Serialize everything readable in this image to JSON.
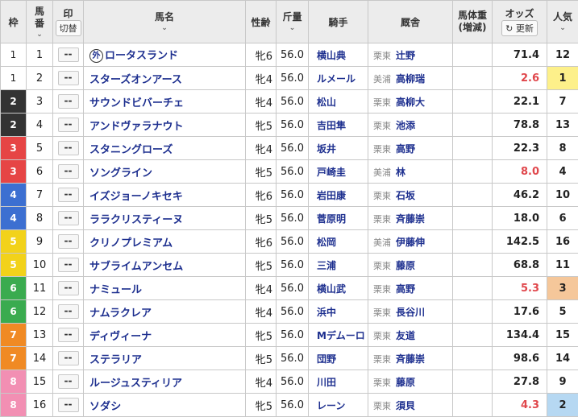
{
  "header": {
    "waku": "枠",
    "umaban_1": "馬",
    "umaban_2": "番",
    "mark": "印",
    "mark_toggle": "切替",
    "horse": "馬名",
    "sex_age": "性齢",
    "weight": "斤量",
    "jockey": "騎手",
    "trainer": "厩舎",
    "body_1": "馬体重",
    "body_2": "(増減)",
    "odds": "オッズ",
    "refresh": "更新",
    "pop_1": "人",
    "pop_2": "気"
  },
  "colors": {
    "waku": {
      "1": "#ffffff",
      "2": "#333333",
      "3": "#e64545",
      "4": "#3c6fd1",
      "5": "#f2d21a",
      "6": "#3aab4f",
      "7": "#f08a24",
      "8": "#f28fb3"
    },
    "waku_text": {
      "1": "#222222",
      "2": "#ffffff",
      "3": "#ffffff",
      "4": "#ffffff",
      "5": "#ffffff",
      "6": "#ffffff",
      "7": "#ffffff",
      "8": "#ffffff"
    },
    "odds_favorite": "#e0474c",
    "pop_1_bg": "#fdf08a",
    "pop_2_bg": "#b6d8f2",
    "pop_3_bg": "#f5c79a"
  },
  "rows": [
    {
      "waku": "1",
      "num": "1",
      "mark": "--",
      "foreign": "外",
      "horse": "ロータスランド",
      "sex": "牝6",
      "weight": "56.0",
      "jockey": "横山典",
      "region": "栗東",
      "trainer": "辻野",
      "body": "",
      "odds": "71.4",
      "pop": "12"
    },
    {
      "waku": "1",
      "num": "2",
      "mark": "--",
      "foreign": "",
      "horse": "スターズオンアース",
      "sex": "牝4",
      "weight": "56.0",
      "jockey": "ルメール",
      "region": "美浦",
      "trainer": "高柳瑞",
      "body": "",
      "odds": "2.6",
      "pop": "1"
    },
    {
      "waku": "2",
      "num": "3",
      "mark": "--",
      "foreign": "",
      "horse": "サウンドビバーチェ",
      "sex": "牝4",
      "weight": "56.0",
      "jockey": "松山",
      "region": "栗東",
      "trainer": "高柳大",
      "body": "",
      "odds": "22.1",
      "pop": "7"
    },
    {
      "waku": "2",
      "num": "4",
      "mark": "--",
      "foreign": "",
      "horse": "アンドヴァラナウト",
      "sex": "牝5",
      "weight": "56.0",
      "jockey": "吉田隼",
      "region": "栗東",
      "trainer": "池添",
      "body": "",
      "odds": "78.8",
      "pop": "13"
    },
    {
      "waku": "3",
      "num": "5",
      "mark": "--",
      "foreign": "",
      "horse": "スタニングローズ",
      "sex": "牝4",
      "weight": "56.0",
      "jockey": "坂井",
      "region": "栗東",
      "trainer": "高野",
      "body": "",
      "odds": "22.3",
      "pop": "8"
    },
    {
      "waku": "3",
      "num": "6",
      "mark": "--",
      "foreign": "",
      "horse": "ソングライン",
      "sex": "牝5",
      "weight": "56.0",
      "jockey": "戸崎圭",
      "region": "美浦",
      "trainer": "林",
      "body": "",
      "odds": "8.0",
      "pop": "4"
    },
    {
      "waku": "4",
      "num": "7",
      "mark": "--",
      "foreign": "",
      "horse": "イズジョーノキセキ",
      "sex": "牝6",
      "weight": "56.0",
      "jockey": "岩田康",
      "region": "栗東",
      "trainer": "石坂",
      "body": "",
      "odds": "46.2",
      "pop": "10"
    },
    {
      "waku": "4",
      "num": "8",
      "mark": "--",
      "foreign": "",
      "horse": "ララクリスティーヌ",
      "sex": "牝5",
      "weight": "56.0",
      "jockey": "菅原明",
      "region": "栗東",
      "trainer": "斉藤崇",
      "body": "",
      "odds": "18.0",
      "pop": "6"
    },
    {
      "waku": "5",
      "num": "9",
      "mark": "--",
      "foreign": "",
      "horse": "クリノプレミアム",
      "sex": "牝6",
      "weight": "56.0",
      "jockey": "松岡",
      "region": "美浦",
      "trainer": "伊藤伸",
      "body": "",
      "odds": "142.5",
      "pop": "16"
    },
    {
      "waku": "5",
      "num": "10",
      "mark": "--",
      "foreign": "",
      "horse": "サブライムアンセム",
      "sex": "牝5",
      "weight": "56.0",
      "jockey": "三浦",
      "region": "栗東",
      "trainer": "藤原",
      "body": "",
      "odds": "68.8",
      "pop": "11"
    },
    {
      "waku": "6",
      "num": "11",
      "mark": "--",
      "foreign": "",
      "horse": "ナミュール",
      "sex": "牝4",
      "weight": "56.0",
      "jockey": "横山武",
      "region": "栗東",
      "trainer": "高野",
      "body": "",
      "odds": "5.3",
      "pop": "3"
    },
    {
      "waku": "6",
      "num": "12",
      "mark": "--",
      "foreign": "",
      "horse": "ナムラクレア",
      "sex": "牝4",
      "weight": "56.0",
      "jockey": "浜中",
      "region": "栗東",
      "trainer": "長谷川",
      "body": "",
      "odds": "17.6",
      "pop": "5"
    },
    {
      "waku": "7",
      "num": "13",
      "mark": "--",
      "foreign": "",
      "horse": "ディヴィーナ",
      "sex": "牝5",
      "weight": "56.0",
      "jockey": "Mデムーロ",
      "region": "栗東",
      "trainer": "友道",
      "body": "",
      "odds": "134.4",
      "pop": "15"
    },
    {
      "waku": "7",
      "num": "14",
      "mark": "--",
      "foreign": "",
      "horse": "ステラリア",
      "sex": "牝5",
      "weight": "56.0",
      "jockey": "団野",
      "region": "栗東",
      "trainer": "斉藤崇",
      "body": "",
      "odds": "98.6",
      "pop": "14"
    },
    {
      "waku": "8",
      "num": "15",
      "mark": "--",
      "foreign": "",
      "horse": "ルージュスティリア",
      "sex": "牝4",
      "weight": "56.0",
      "jockey": "川田",
      "region": "栗東",
      "trainer": "藤原",
      "body": "",
      "odds": "27.8",
      "pop": "9"
    },
    {
      "waku": "8",
      "num": "16",
      "mark": "--",
      "foreign": "",
      "horse": "ソダシ",
      "sex": "牝5",
      "weight": "56.0",
      "jockey": "レーン",
      "region": "栗東",
      "trainer": "須貝",
      "body": "",
      "odds": "4.3",
      "pop": "2"
    }
  ]
}
